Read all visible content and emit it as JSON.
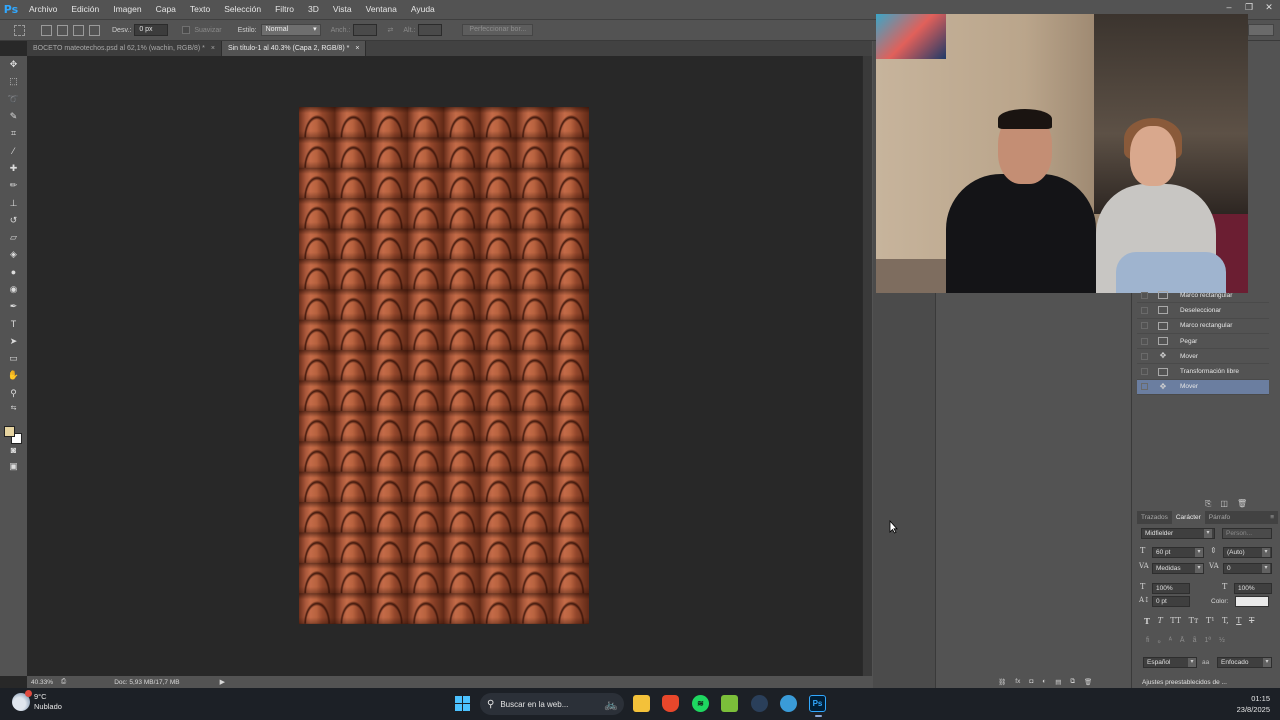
{
  "app": {
    "logo": "Ps"
  },
  "menu": [
    "Archivo",
    "Edición",
    "Imagen",
    "Capa",
    "Texto",
    "Selección",
    "Filtro",
    "3D",
    "Vista",
    "Ventana",
    "Ayuda"
  ],
  "options": {
    "desv_label": "Desv.:",
    "desv_value": "0 px",
    "suavizar": "Suavizar",
    "estilo_label": "Estilo:",
    "estilo_value": "Normal",
    "anch_label": "Anch.:",
    "alt_label": "Alt.:",
    "refine_button": "Perfeccionar bor..."
  },
  "tabs": [
    {
      "label": "BOCETO mateotechos.psd al 62,1% (wachin, RGB/8) *",
      "close": "×"
    },
    {
      "label": "Sin título-1 al 40.3% (Capa 2, RGB/8) *",
      "close": "×"
    }
  ],
  "status": {
    "zoom": "40.33%",
    "doc": "Doc: 5,93 MB/17,7 MB"
  },
  "history": [
    {
      "label": "Marco rectangular",
      "icon": "document-icon"
    },
    {
      "label": "Deseleccionar",
      "icon": "document-icon"
    },
    {
      "label": "Marco rectangular",
      "icon": "document-icon"
    },
    {
      "label": "Pegar",
      "icon": "document-icon"
    },
    {
      "label": "Mover",
      "icon": "move-icon"
    },
    {
      "label": "Transformación libre",
      "icon": "document-icon"
    },
    {
      "label": "Mover",
      "icon": "move-icon",
      "selected": true
    }
  ],
  "character": {
    "tabs": [
      "Trazados",
      "Carácter",
      "Párrafo"
    ],
    "font_family": "Midfielder",
    "font_style": "Person...",
    "font_size": "60 pt",
    "leading": "(Auto)",
    "kerning": "Medidas",
    "tracking": "0",
    "vscale": "100%",
    "hscale": "100%",
    "baseline": "0 pt",
    "color_label": "Color:",
    "color_value": "#eaeaea",
    "language": "Español",
    "antialias_icon": "aa",
    "antialias": "Enfocado",
    "type_buttons": [
      "T",
      "T",
      "TT",
      "Tт",
      "T¹",
      "T,",
      "T",
      "T"
    ]
  },
  "panel_bottom": {
    "adjustments": "Ajustes preestablecidos de ..."
  },
  "taskbar": {
    "temp": "9°C",
    "weather": "Nublado",
    "search_placeholder": "Buscar en la web...",
    "time": "01:15",
    "date": "23/8/2025"
  }
}
